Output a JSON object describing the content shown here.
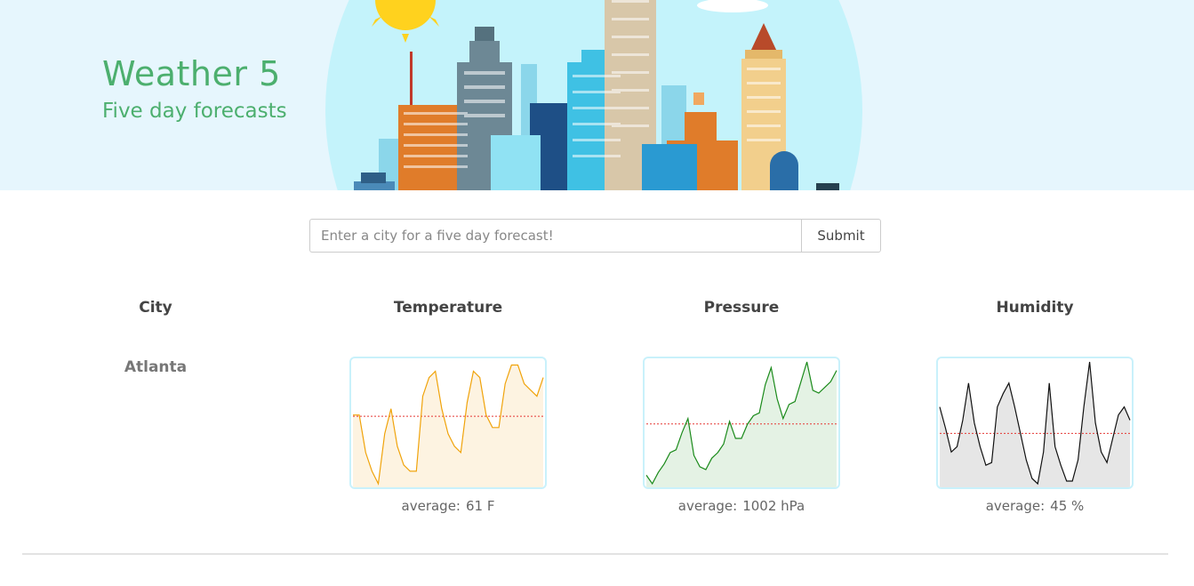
{
  "header": {
    "title": "Weather 5",
    "subtitle": "Five day forecasts"
  },
  "search": {
    "placeholder": "Enter a city for a five day forecast!",
    "value": "",
    "submit_label": "Submit"
  },
  "table": {
    "headers": {
      "city": "City",
      "temperature": "Temperature",
      "pressure": "Pressure",
      "humidity": "Humidity"
    },
    "rows": [
      {
        "city": "Atlanta",
        "temperature": {
          "average_label": "average:",
          "average_value": "61 F"
        },
        "pressure": {
          "average_label": "average:",
          "average_value": "1002 hPa"
        },
        "humidity": {
          "average_label": "average:",
          "average_value": "45 %"
        }
      }
    ]
  },
  "colors": {
    "brand": "#4caf6e",
    "temperature_line": "#f0a30a",
    "temperature_fill": "#fdf3e1",
    "pressure_line": "#1a8a1a",
    "pressure_fill": "#e4f2e4",
    "humidity_line": "#111111",
    "humidity_fill": "#e6e6e6",
    "average_line": "#e53935",
    "sparkline_border": "#c9f1fb"
  },
  "chart_data": [
    {
      "type": "area",
      "series": [
        {
          "values": [
            57,
            57,
            51,
            48,
            46,
            54,
            58,
            52,
            49,
            48,
            48,
            60,
            63,
            64,
            58,
            54,
            52,
            51,
            59,
            64,
            63,
            57,
            55,
            55,
            62,
            65,
            65,
            62,
            61,
            60,
            63
          ]
        }
      ],
      "reference_line": "average",
      "ylim": [
        46,
        65.5
      ]
    },
    {
      "type": "area",
      "series": [
        {
          "values": [
            975,
            972,
            976,
            979,
            983,
            984,
            990,
            995,
            982,
            978,
            977,
            981,
            983,
            986,
            994,
            988,
            988,
            993,
            996,
            997,
            1007,
            1013,
            1002,
            995,
            1000,
            1001,
            1008,
            1015,
            1005,
            1004,
            1006,
            1008,
            1012
          ]
        }
      ],
      "reference_line": "average",
      "ylim": [
        972,
        1015
      ]
    },
    {
      "type": "area",
      "series": [
        {
          "values": [
            55,
            47,
            38,
            40,
            50,
            64,
            49,
            40,
            33,
            34,
            55,
            60,
            64,
            55,
            45,
            35,
            28,
            26,
            38,
            64,
            40,
            33,
            27,
            27,
            35,
            55,
            72,
            49,
            38,
            34,
            43,
            52,
            55,
            50
          ]
        }
      ],
      "reference_line": "average",
      "ylim": [
        26,
        72
      ]
    }
  ]
}
